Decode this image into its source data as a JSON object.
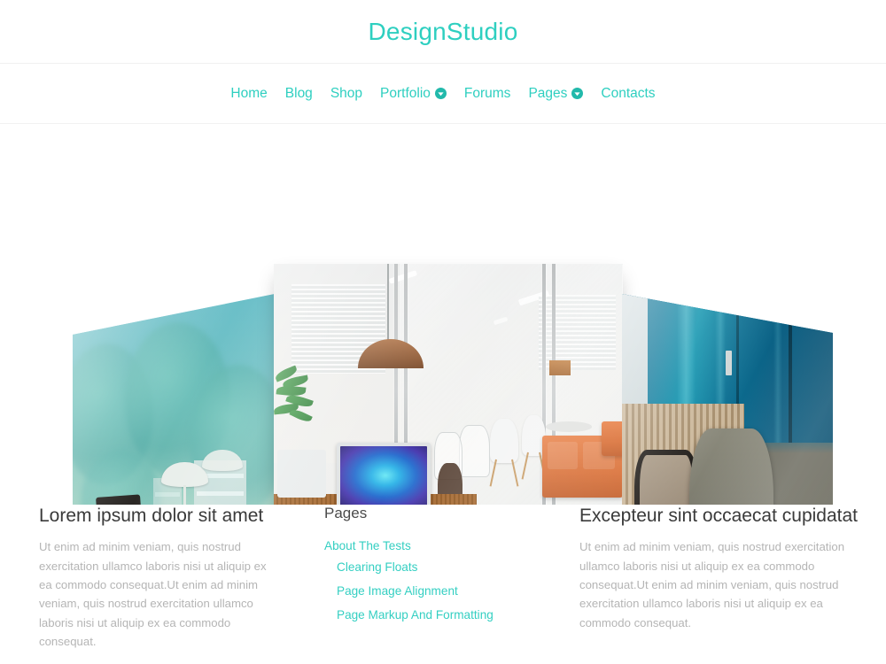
{
  "header": {
    "logo": "DesignStudio"
  },
  "nav": {
    "items": [
      {
        "label": "Home",
        "has_dropdown": false,
        "icon": ""
      },
      {
        "label": "Blog",
        "has_dropdown": false,
        "icon": ""
      },
      {
        "label": "Shop",
        "has_dropdown": false,
        "icon": ""
      },
      {
        "label": "Portfolio",
        "has_dropdown": true,
        "icon": "chevron-down-circle-icon"
      },
      {
        "label": "Forums",
        "has_dropdown": false,
        "icon": ""
      },
      {
        "label": "Pages",
        "has_dropdown": true,
        "icon": "chevron-down-circle-icon"
      },
      {
        "label": "Contacts",
        "has_dropdown": false,
        "icon": ""
      }
    ]
  },
  "slider": {
    "slides": [
      {
        "name": "left-slide",
        "alt": "Teal tinted balcony office with lamp and chair overlooking trees"
      },
      {
        "name": "center-slide",
        "alt": "Bright modern office with iMac on white desk, glass partitions, orange sofa and wood floor"
      },
      {
        "name": "right-slide",
        "alt": "Office chairs in front of teal wall with wooden slat panelling"
      }
    ],
    "prev_label": "‹",
    "next_label": "›"
  },
  "content": {
    "columns": [
      {
        "title": "Lorem ipsum dolor sit amet",
        "body": "Ut enim ad minim veniam, quis nostrud exercitation ullamco laboris nisi ut aliquip ex ea commodo consequat.Ut enim ad minim veniam, quis nostrud exercitation ullamco laboris nisi ut aliquip ex ea commodo consequat."
      },
      {
        "title": "Pages",
        "links": [
          {
            "label": "About The Tests"
          },
          {
            "label": "Clearing Floats"
          },
          {
            "label": "Page Image Alignment"
          },
          {
            "label": "Page Markup And Formatting"
          }
        ]
      },
      {
        "title": "Excepteur sint occaecat cupidatat",
        "body": "Ut enim ad minim veniam, quis nostrud exercitation ullamco laboris nisi ut aliquip ex ea commodo consequat.Ut enim ad minim veniam, quis nostrud exercitation ullamco laboris nisi ut aliquip ex ea commodo consequat."
      }
    ]
  },
  "colors": {
    "accent": "#2ECFC0",
    "accent_dark": "#22B9AB",
    "heading": "#3A3A3A",
    "body_text": "#B5B5B5",
    "background": "#FFFFFF"
  }
}
